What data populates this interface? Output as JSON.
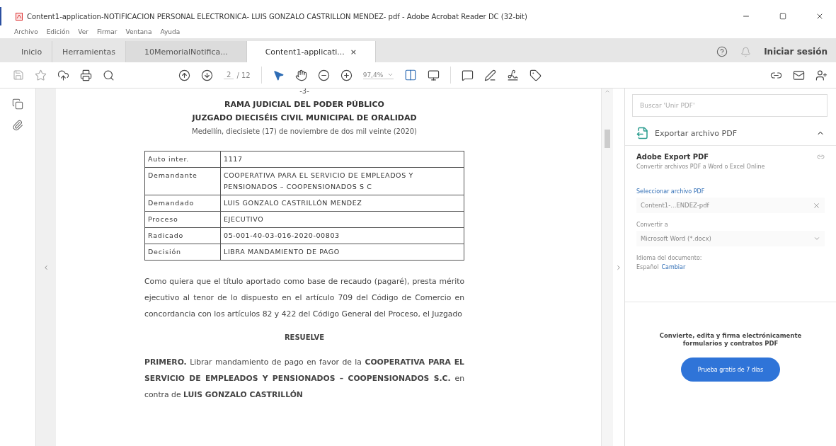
{
  "window": {
    "title": "Content1-application-NOTIFICACION PERSONAL ELECTRONICA- LUIS GONZALO CASTRILLON MENDEZ- pdf - Adobe Acrobat Reader DC (32-bit)"
  },
  "menu": [
    "Archivo",
    "Edición",
    "Ver",
    "Firmar",
    "Ventana",
    "Ayuda"
  ],
  "tabs": [
    {
      "label": "Inicio",
      "selected": false,
      "kind": "nav"
    },
    {
      "label": "Herramientas",
      "selected": false,
      "kind": "nav"
    },
    {
      "label": "10MemorialNotifica...",
      "selected": false,
      "kind": "doc"
    },
    {
      "label": "Content1-applicati...",
      "selected": true,
      "kind": "doc",
      "close": "×"
    }
  ],
  "signin": "Iniciar sesión",
  "toolbar": {
    "page": "2",
    "page_total": "/ 12",
    "zoom": "97,4%"
  },
  "document": {
    "page_mark": "-3-",
    "headings": [
      "RAMA JUDICIAL DEL PODER PÚBLICO",
      "JUZGADO DIECISÉIS CIVIL MUNICIPAL DE ORALIDAD"
    ],
    "date": "Medellín, diecisiete (17) de noviembre de dos mil veinte (2020)",
    "table": [
      {
        "label": "Auto inter.",
        "value": "1117"
      },
      {
        "label": "Demandante",
        "value": "COOPERATIVA PARA EL SERVICIO DE EMPLEADOS Y PENSIONADOS – COOPENSIONADOS S C"
      },
      {
        "label": "Demandado",
        "value": "LUIS GONZALO CASTRILLÓN MENDEZ"
      },
      {
        "label": "Proceso",
        "value": "EJECUTIVO"
      },
      {
        "label": "Radicado",
        "value": "05-001-40-03-016-2020-00803"
      },
      {
        "label": "Decisión",
        "value": "LIBRA MANDAMIENTO DE PAGO"
      }
    ],
    "paragraph": "Como quiera que el título aportado como base de recaudo (pagaré), presta mérito ejecutivo al tenor de lo dispuesto en el artículo 709 del Código de Comercio en concordancia con los artículos 82 y 422 del Código General del Proceso, el Juzgado",
    "resolve": "RESUELVE",
    "first": "**PRIMERO.** Librar mandamiento de pago en favor de la **COOPERATIVA PARA EL SERVICIO DE EMPLEADOS Y PENSIONADOS – COOPENSIONADOS S.C.** en contra de **LUIS GONZALO CASTRILLÓN**"
  },
  "pane": {
    "search": {
      "placeholder": "Buscar 'Unir PDF'"
    },
    "section": {
      "title": "Exportar archivo PDF",
      "expanded": true
    },
    "heading": "Adobe Export PDF",
    "subtitle": "Convertir archivos PDF a Word o Excel Online",
    "select_label": "Seleccionar archivo PDF",
    "file": "Content1-...ENDEZ-pdf",
    "convert_label": "Convertir a",
    "format": "Microsoft Word (*.docx)",
    "language_label": "Idioma del documento:",
    "language": "Español",
    "change": "Cambiar",
    "promo": "Convierte, edita y firma electrónicamente formularios y contratos PDF",
    "trial": "Prueba gratis de 7 días"
  }
}
